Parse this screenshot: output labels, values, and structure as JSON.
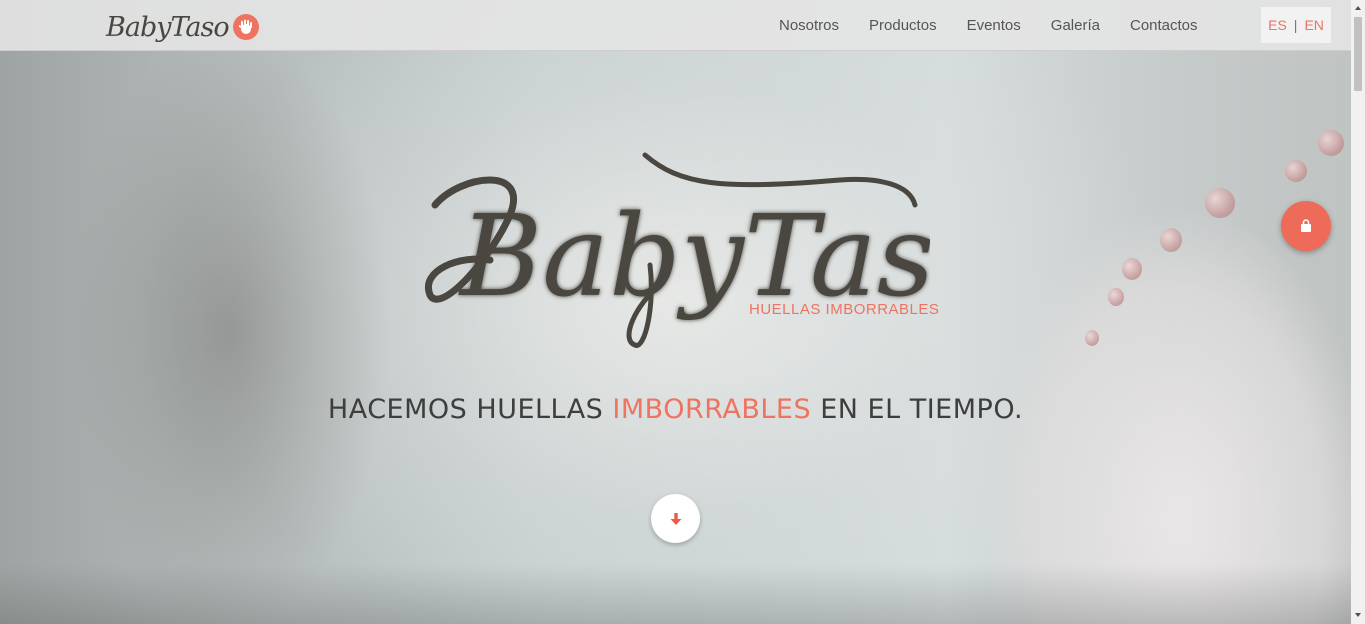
{
  "brand": {
    "name": "BabyTaso",
    "icon": "hand-icon"
  },
  "nav": {
    "items": [
      {
        "label": "Nosotros"
      },
      {
        "label": "Productos"
      },
      {
        "label": "Eventos"
      },
      {
        "label": "Galería"
      },
      {
        "label": "Contactos"
      }
    ]
  },
  "language": {
    "es": "ES",
    "separator": "|",
    "en": "EN"
  },
  "hero": {
    "logo_text": "BabyTaso",
    "logo_subtitle": "HUELLAS IMBORRABLES",
    "tagline_before": "HACEMOS HUELLAS ",
    "tagline_accent": "IMBORRABLES",
    "tagline_after": " EN EL TIEMPO.",
    "scroll_icon": "arrow-down-icon",
    "cart_icon": "shopping-bag-icon"
  },
  "colors": {
    "accent": "#ee7360",
    "logo": "#4a4740",
    "text": "#3e3e3e"
  }
}
